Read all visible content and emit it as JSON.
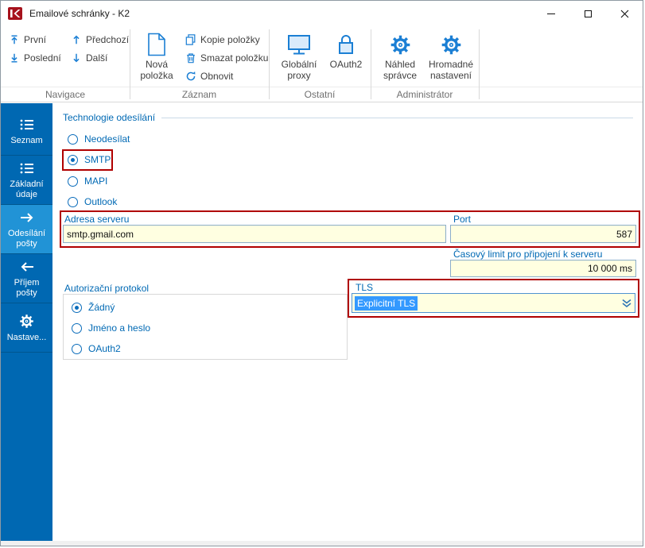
{
  "window": {
    "title": "Emailové schránky - K2"
  },
  "ribbon": {
    "groups": [
      {
        "label": "Navigace",
        "items": [
          {
            "label": "První"
          },
          {
            "label": "Poslední"
          },
          {
            "label": "Předchozí"
          },
          {
            "label": "Další"
          }
        ]
      },
      {
        "label": "Záznam",
        "items": [
          {
            "label": "Nová položka"
          },
          {
            "label": "Kopie položky"
          },
          {
            "label": "Smazat položku"
          },
          {
            "label": "Obnovit"
          }
        ]
      },
      {
        "label": "Ostatní",
        "items": [
          {
            "label": "Globální proxy"
          },
          {
            "label": "OAuth2"
          }
        ]
      },
      {
        "label": "Administrátor",
        "items": [
          {
            "label": "Náhled správce"
          },
          {
            "label": "Hromadné nastavení"
          }
        ]
      }
    ]
  },
  "sidebar": {
    "items": [
      {
        "label": "Seznam",
        "selected": false
      },
      {
        "label": "Základní údaje",
        "selected": false
      },
      {
        "label": "Odesílání pošty",
        "selected": true
      },
      {
        "label": "Příjem pošty",
        "selected": false
      },
      {
        "label": "Nastave...",
        "selected": false
      }
    ]
  },
  "form": {
    "sending_technology": {
      "label": "Technologie odesílání",
      "options": [
        {
          "label": "Neodesílat",
          "selected": false
        },
        {
          "label": "SMTP",
          "selected": true
        },
        {
          "label": "MAPI",
          "selected": false
        },
        {
          "label": "Outlook",
          "selected": false
        }
      ]
    },
    "server_address": {
      "label": "Adresa serveru",
      "value": "smtp.gmail.com"
    },
    "port": {
      "label": "Port",
      "value": "587"
    },
    "timeout": {
      "label": "Časový limit pro připojení k serveru",
      "value": "10 000 ms"
    },
    "auth_protocol": {
      "label": "Autorizační protokol",
      "options": [
        {
          "label": "Žádný",
          "selected": true
        },
        {
          "label": "Jméno a heslo",
          "selected": false
        },
        {
          "label": "OAuth2",
          "selected": false
        }
      ]
    },
    "tls": {
      "label": "TLS",
      "value": "Explicitní TLS"
    }
  },
  "colors": {
    "accent_blue": "#0069b4",
    "sidebar_blue": "#0068b2",
    "sidebar_selected": "#2193d6",
    "field_bg": "#ffffe1",
    "annotation_red": "#b00000",
    "selection_blue": "#3399ff",
    "icon_blue": "#1b7fd4"
  }
}
